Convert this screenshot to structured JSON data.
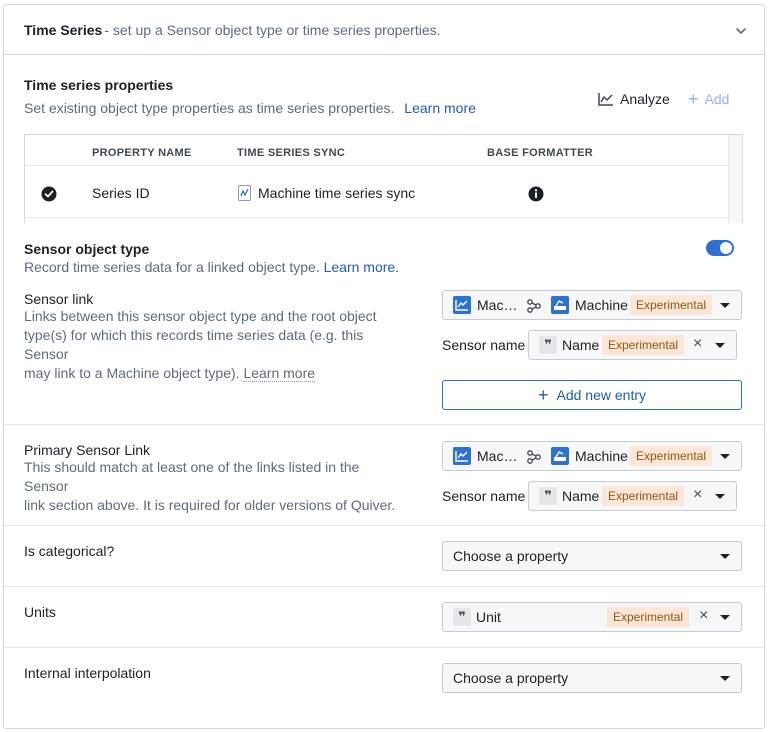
{
  "header": {
    "title": "Time Series",
    "subtitle": "- set up a Sensor object type or time series properties."
  },
  "ts_properties": {
    "title": "Time series properties",
    "description": "Set existing object type properties as time series properties.",
    "learn_more": "Learn more",
    "analyze_label": "Analyze",
    "add_label": "Add",
    "columns": [
      "PROPERTY NAME",
      "TIME SERIES SYNC",
      "BASE FORMATTER"
    ],
    "rows": [
      {
        "property_name": "Series ID",
        "sync": "Machine time series sync"
      }
    ]
  },
  "sensor_object_type": {
    "title": "Sensor object type",
    "description": "Record time series data for a linked object type.",
    "learn_more": "Learn more.",
    "enabled": true
  },
  "sensor_link": {
    "title": "Sensor link",
    "desc_line1": "Links between this sensor object type and the root object",
    "desc_line2": "type(s) for which this records time series data (e.g. this Sensor",
    "desc_line3": "may link to a Machine object type).",
    "learn_more": "Learn more",
    "from_object": "Mac…",
    "to_object": "Machine",
    "tag": "Experimental",
    "sensor_name_label": "Sensor name",
    "sensor_name_value": "Name",
    "sensor_name_tag": "Experimental",
    "add_entry_label": "Add new entry"
  },
  "primary_sensor_link": {
    "title": "Primary Sensor Link",
    "desc_line1": "This should match at least one of the links listed in the Sensor",
    "desc_line2": "link section above. It is required for older versions of Quiver.",
    "from_object": "Mac…",
    "to_object": "Machine",
    "tag": "Experimental",
    "sensor_name_label": "Sensor name",
    "sensor_name_value": "Name",
    "sensor_name_tag": "Experimental"
  },
  "is_categorical": {
    "title": "Is categorical?",
    "placeholder": "Choose a property"
  },
  "units": {
    "title": "Units",
    "value": "Unit",
    "tag": "Experimental"
  },
  "internal_interpolation": {
    "title": "Internal interpolation",
    "placeholder": "Choose a property"
  },
  "colors": {
    "accent": "#2d72d2",
    "link": "#215db0",
    "tag_bg": "#fbe6d7",
    "tag_text": "#935610"
  }
}
